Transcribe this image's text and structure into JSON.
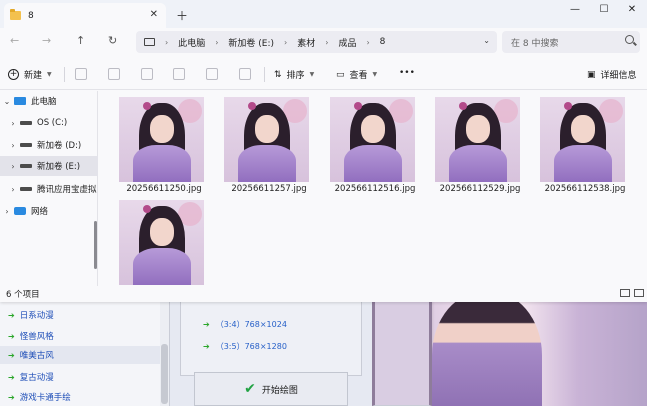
{
  "window": {
    "tab_title": "8",
    "controls": {
      "minimize": "—",
      "maximize": "☐",
      "close": "✕"
    }
  },
  "nav": {
    "back": "←",
    "forward": "→",
    "up": "↑",
    "refresh": "↻",
    "breadcrumb": [
      "此电脑",
      "新加卷 (E:)",
      "素材",
      "成品",
      "8"
    ],
    "search_placeholder": "在 8 中搜索"
  },
  "toolbar": {
    "new_label": "新建",
    "sort_label": "排序",
    "view_label": "查看",
    "more_label": "•••",
    "details_label": "详细信息"
  },
  "sidebar": {
    "items": [
      {
        "label": "此电脑",
        "icon": "pc-icon",
        "chev": "⌄"
      },
      {
        "label": "OS (C:)",
        "icon": "drive-icon",
        "chev": "›"
      },
      {
        "label": "新加卷 (D:)",
        "icon": "drive-icon",
        "chev": "›"
      },
      {
        "label": "新加卷 (E:)",
        "icon": "drive-icon",
        "chev": "›",
        "selected": true
      },
      {
        "label": "腾讯应用宝虚拟",
        "icon": "drive-icon",
        "chev": "›"
      },
      {
        "label": "网络",
        "icon": "network-icon",
        "chev": "›"
      }
    ]
  },
  "files": [
    {
      "name": "20256611250.jpg"
    },
    {
      "name": "20256611257.jpg"
    },
    {
      "name": "202566112516.jpg"
    },
    {
      "name": "202566112529.jpg"
    },
    {
      "name": "202566112538.jpg"
    },
    {
      "name": ""
    }
  ],
  "status": {
    "count": "6 个项目"
  },
  "background_app": {
    "list": [
      "日系动漫",
      "怪兽风格",
      "唯美古风",
      "复古动漫",
      "游戏卡通手绘"
    ],
    "selected_index": 2,
    "sizes": [
      "（3:4）768×1024",
      "（3:5）768×1280"
    ],
    "button": "开始绘图"
  }
}
